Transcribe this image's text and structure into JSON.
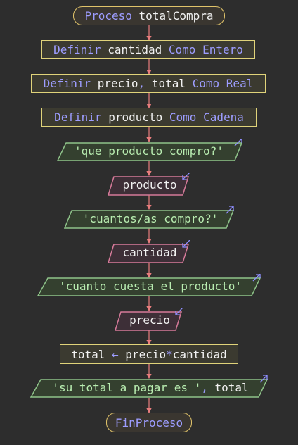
{
  "flowchart": {
    "start": {
      "keyword": "Proceso",
      "name": "totalCompra"
    },
    "def1": {
      "kw1": "Definir",
      "vars": "cantidad",
      "kw2": "Como",
      "type": "Entero"
    },
    "def2": {
      "kw1": "Definir",
      "var1": "precio",
      "sep": ",",
      "var2": "total",
      "kw2": "Como",
      "type": "Real"
    },
    "def3": {
      "kw1": "Definir",
      "vars": "producto",
      "kw2": "Como",
      "type": "Cadena"
    },
    "out1": "'que producto compro?'",
    "in1": "producto",
    "out2": "'cuantos/as compro?'",
    "in2": "cantidad",
    "out3": "'cuanto cuesta el producto'",
    "in3": "precio",
    "assign": {
      "target": "total",
      "arrow": "←",
      "left": "precio",
      "op": "*",
      "right": "cantidad"
    },
    "out4": {
      "str": "'su total a pagar es '",
      "sep": ",",
      "var": "total"
    },
    "end": "FinProceso"
  },
  "colors": {
    "background": "#2d2d2d",
    "connector": "#e87d7d",
    "terminal_border": "#e0c36a",
    "process_border": "#e0d37a",
    "output_border": "#8fc48a",
    "input_border": "#d77a9a",
    "keyword": "#9d9dff",
    "string": "#b8ecb0"
  }
}
